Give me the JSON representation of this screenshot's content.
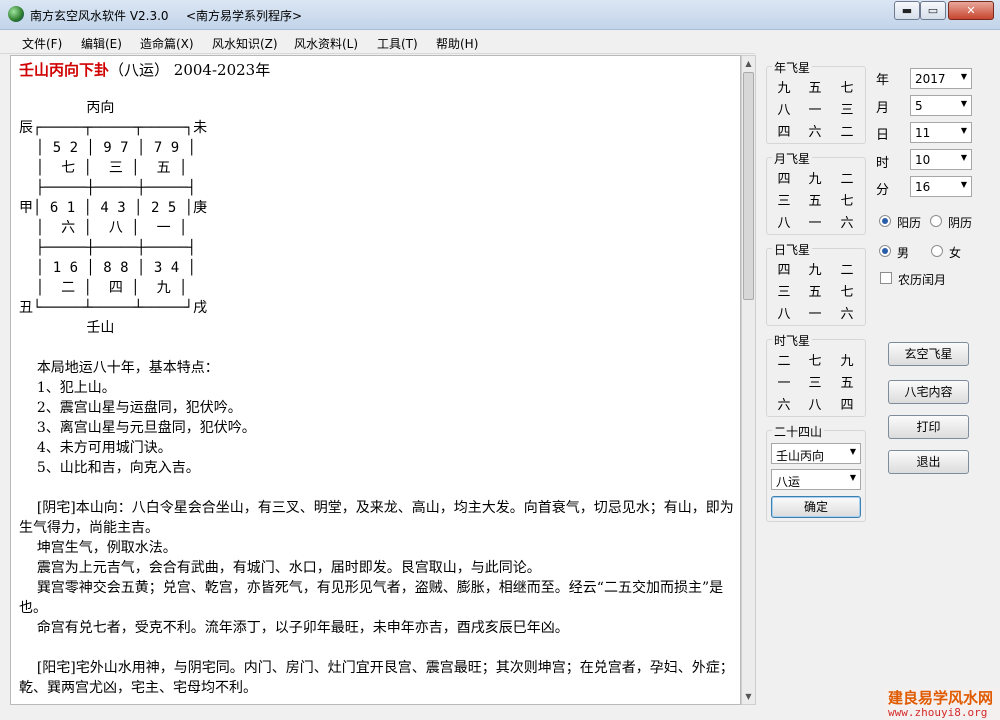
{
  "window": {
    "title": "南方玄空风水软件 V2.3.0",
    "subtitle": "<南方易学系列程序>",
    "controls": {
      "minimize": "▬",
      "maximize": "▭",
      "close": "✕"
    }
  },
  "menu": [
    "文件(F)",
    "编辑(E)",
    "造命篇(X)",
    "风水知识(Z)",
    "风水资料(L)",
    "工具(T)",
    "帮助(H)"
  ],
  "doc": {
    "header_red": "壬山丙向下卦",
    "header_rest": "（八运） 2004-2023年",
    "grid": [
      "        丙向",
      "辰┌─────┬─────┬─────┐未",
      "  │ 5 2 │ 9 7 │ 7 9 │",
      "  │  七 │  三 │  五 │",
      "  ├─────┼─────┼─────┤",
      "甲│ 6 1 │ 4 3 │ 2 5 │庚",
      "  │  六 │  八 │  一 │",
      "  ├─────┼─────┼─────┤",
      "  │ 1 6 │ 8 8 │ 3 4 │",
      "  │  二 │  四 │  九 │",
      "丑└─────┴─────┴─────┘戌",
      "        壬山"
    ],
    "paragraphs": [
      "    本局地运八十年，基本特点：",
      "    1、犯上山。",
      "    2、震宫山星与运盘同，犯伏吟。",
      "    3、离宫山星与元旦盘同，犯伏吟。",
      "    4、未方可用城门诀。",
      "    5、山比和吉，向克入吉。",
      "",
      "    [阴宅]本山向：八白令星会合坐山，有三叉、明堂，及来龙、高山，均主大发。向首衰气，切忌见水；有山，即为生气得力，尚能主吉。",
      "    坤宫生气，例取水法。",
      "    震宫为上元吉气，会合有武曲，有城门、水口，届时即发。艮宫取山，与此同论。",
      "    巽宫零神交会五黄；兑宫、乾宫，亦皆死气，有见形见气者，盗贼、膨胀，相继而至。经云“二五交加而损主”是也。",
      "    命宫有兑七者，受克不利。流年添丁，以子卯年最旺，未申年亦吉，酉戌亥辰巳年凶。",
      "",
      "    [阳宅]宅外山水用神，与阴宅同。内门、房门、灶门宜开艮宫、震宫最旺；其次则坤宫；在兑宫者，孕妇、外症；乾、巽两宫尤凶，宅主、宅母均不利。"
    ]
  },
  "stars": {
    "year": {
      "title": "年飞星",
      "cells": [
        "九",
        "五",
        "七",
        "八",
        "一",
        "三",
        "四",
        "六",
        "二"
      ]
    },
    "month": {
      "title": "月飞星",
      "cells": [
        "四",
        "九",
        "二",
        "三",
        "五",
        "七",
        "八",
        "一",
        "六"
      ]
    },
    "day": {
      "title": "日飞星",
      "cells": [
        "四",
        "九",
        "二",
        "三",
        "五",
        "七",
        "八",
        "一",
        "六"
      ]
    },
    "hour": {
      "title": "时飞星",
      "cells": [
        "二",
        "七",
        "九",
        "一",
        "三",
        "五",
        "六",
        "八",
        "四"
      ]
    }
  },
  "date": {
    "year_label": "年",
    "year_value": "2017",
    "month_label": "月",
    "month_value": "5",
    "day_label": "日",
    "day_value": "11",
    "hour_label": "时",
    "hour_value": "10",
    "minute_label": "分",
    "minute_value": "16"
  },
  "options": {
    "solar_label": "阳历",
    "lunar_label": "阴历",
    "calendar_selected": "阳历",
    "male_label": "男",
    "female_label": "女",
    "gender_selected": "男",
    "leap_label": "农历闰月",
    "leap_checked": false
  },
  "mountains": {
    "title": "二十四山",
    "mountain_value": "壬山丙向",
    "period_value": "八运",
    "confirm_label": "确定"
  },
  "buttons": {
    "xuankong": "玄空飞星",
    "bazhai": "八宅内容",
    "print": "打印",
    "exit": "退出"
  },
  "watermark": {
    "title": "建良易学风水网",
    "url": "www.zhouyi8.org"
  }
}
